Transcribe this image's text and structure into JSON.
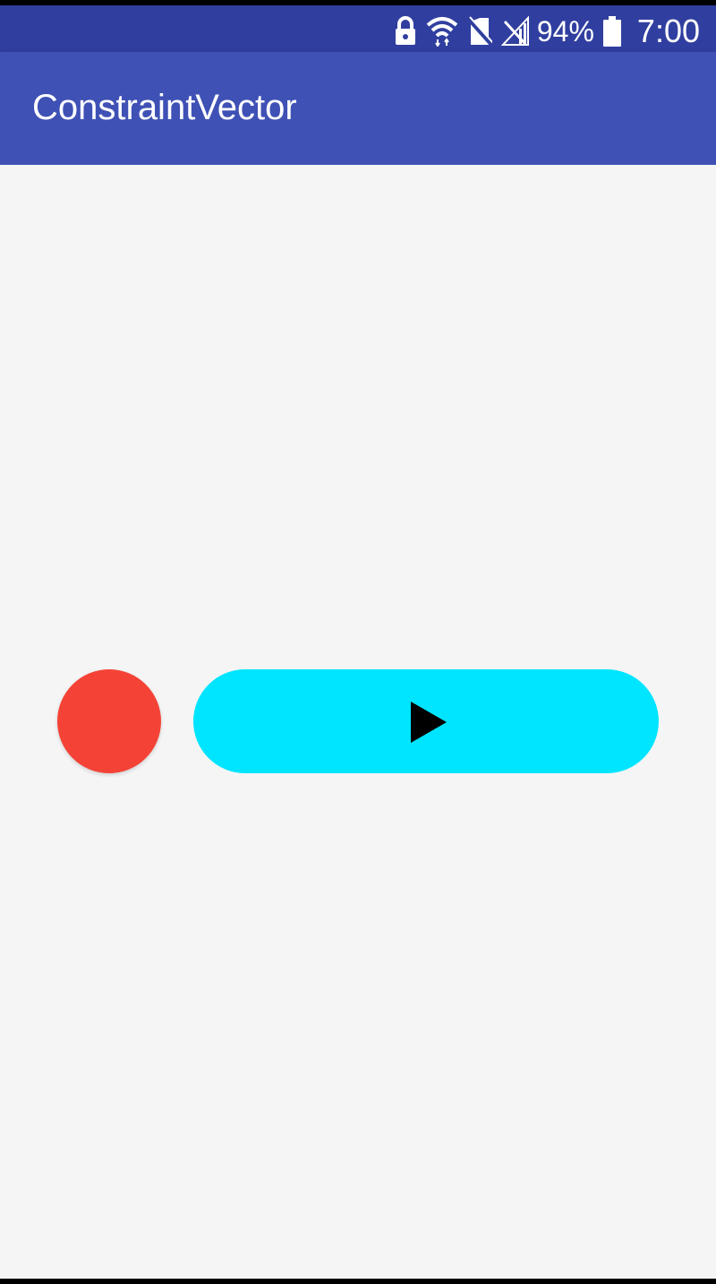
{
  "status_bar": {
    "battery_percent": "94%",
    "time": "7:00",
    "icons": [
      "lock-icon",
      "wifi-icon",
      "no-sim-icon",
      "signal-icon",
      "battery-icon"
    ]
  },
  "app_bar": {
    "title": "ConstraintVector"
  },
  "controls": {
    "record_color": "#F44336",
    "play_color": "#00E5FF"
  },
  "theme": {
    "primary": "#3F51B5",
    "primary_dark": "#303F9F",
    "background": "#f5f5f5"
  }
}
